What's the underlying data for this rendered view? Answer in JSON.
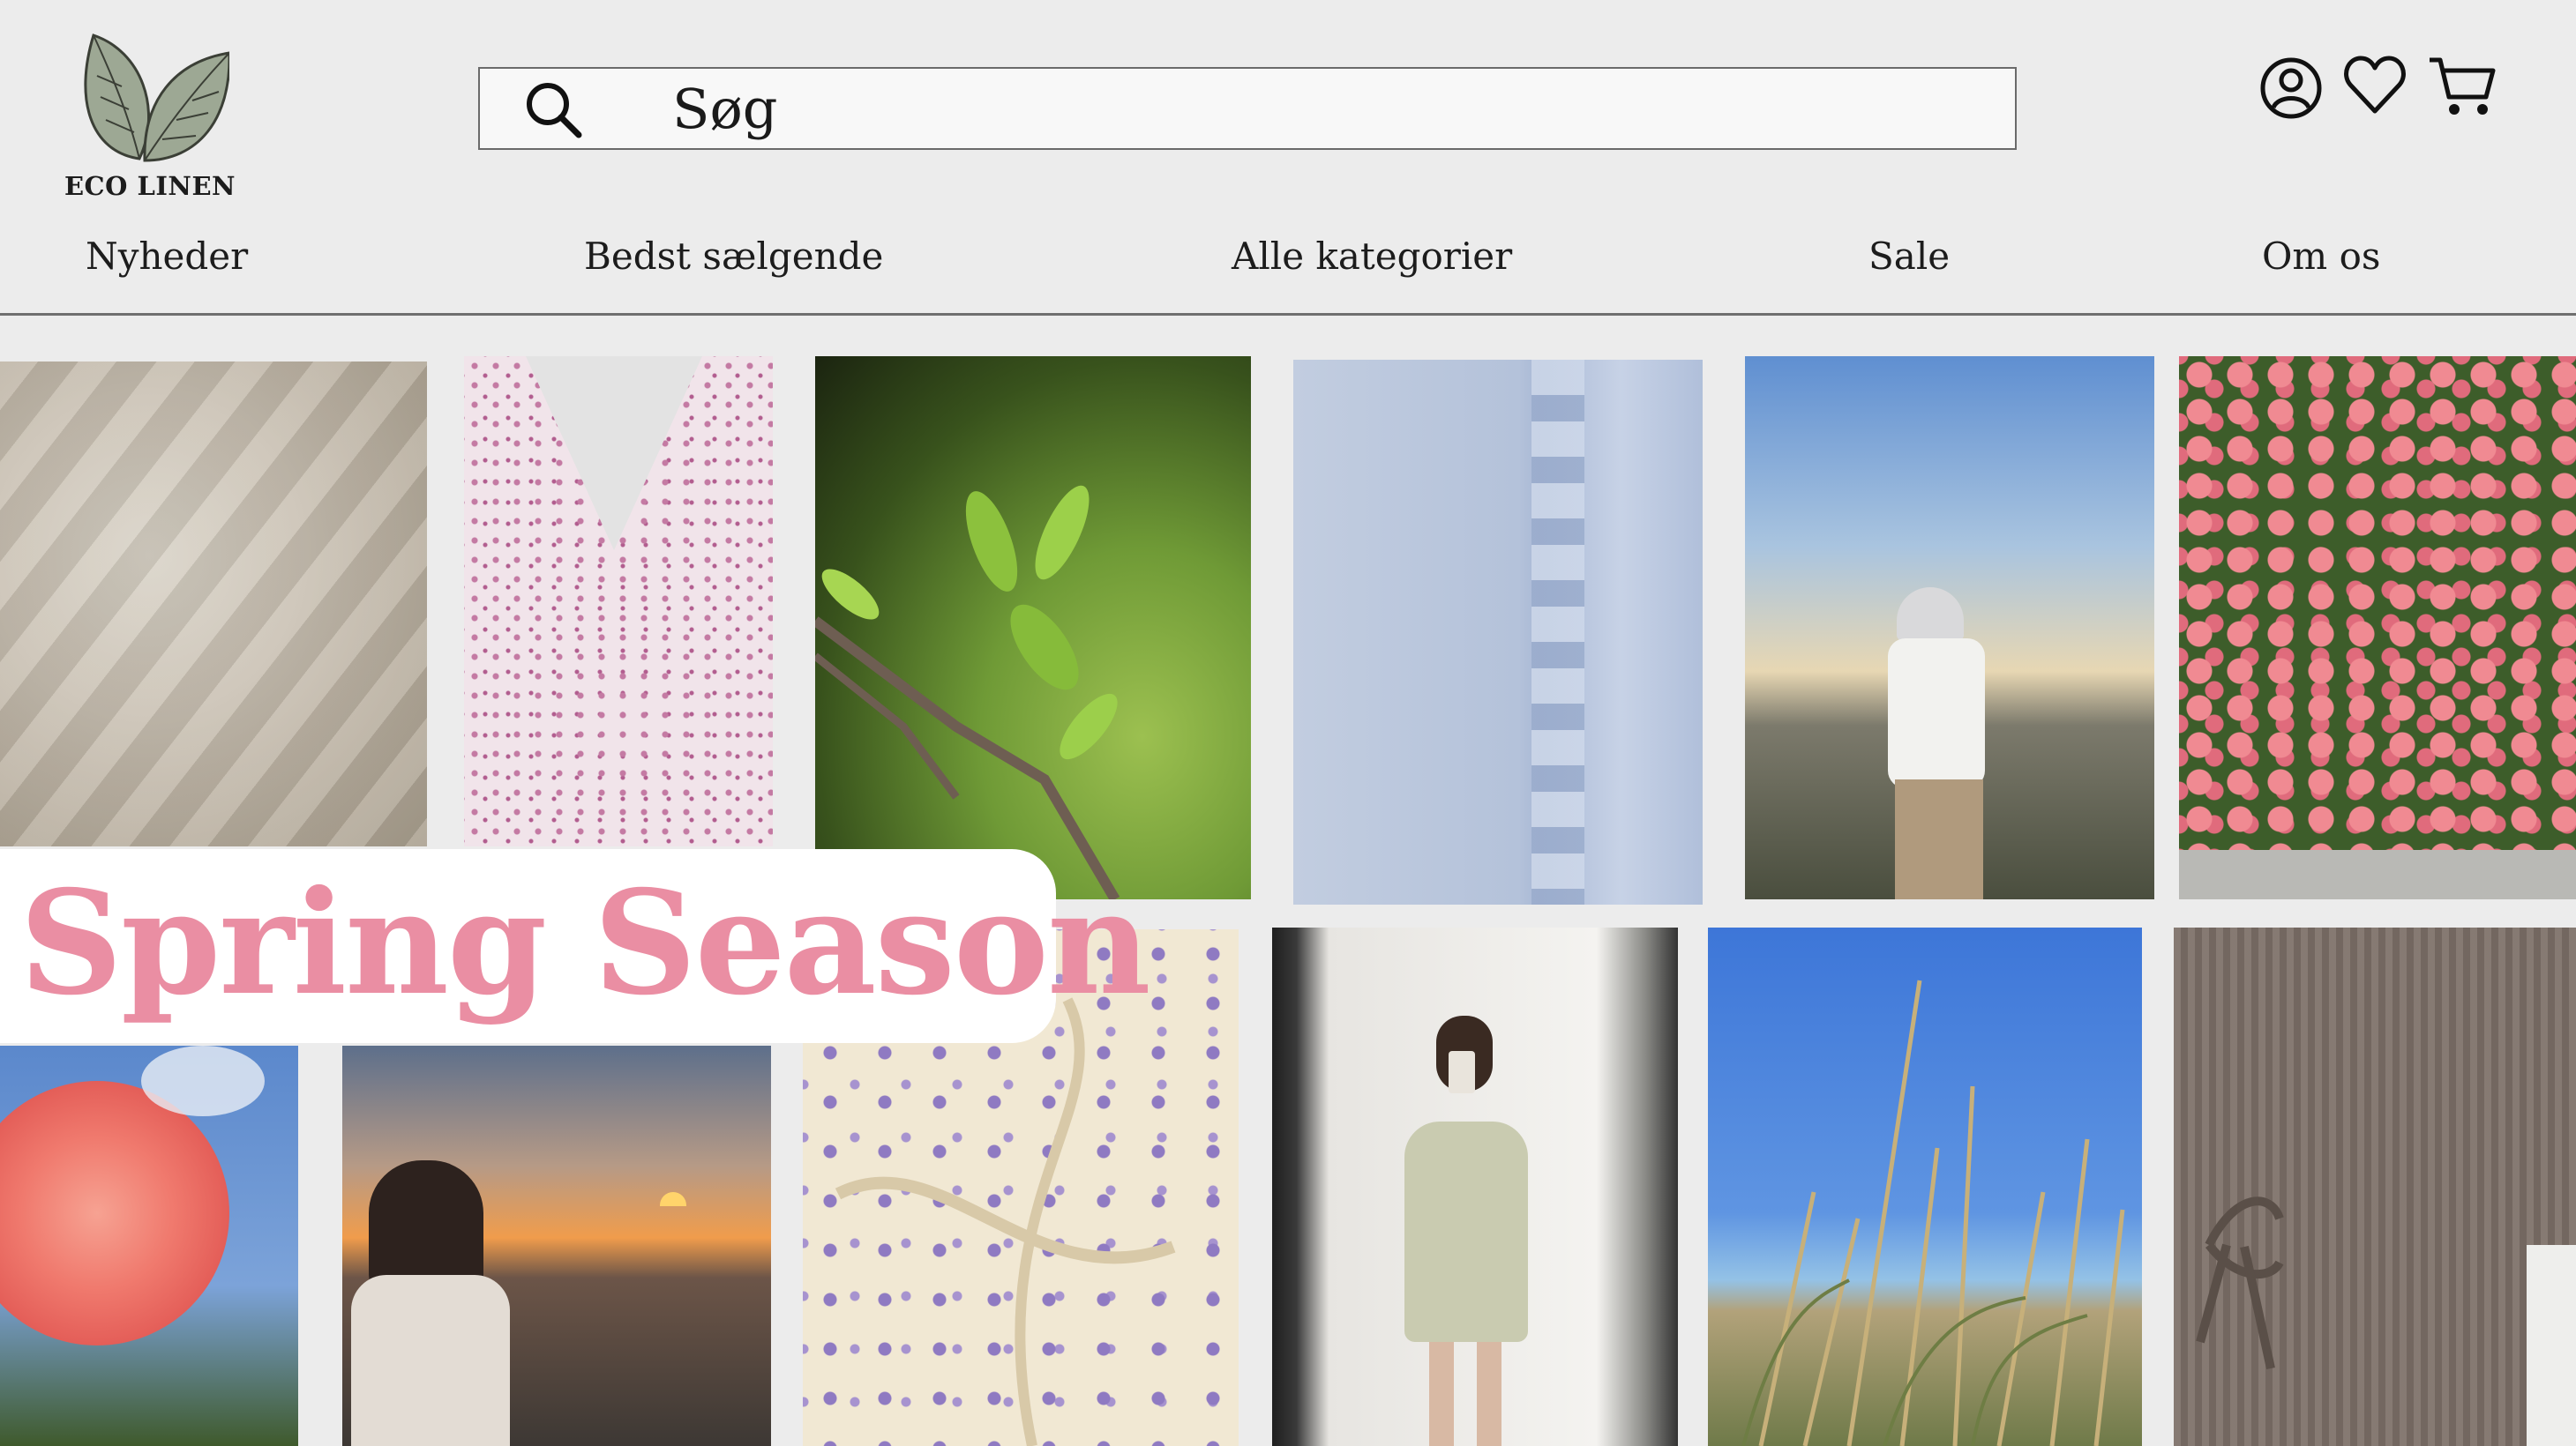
{
  "brand": {
    "name": "ECO LINEN",
    "leaf_color": "#9da894",
    "leaf_stroke": "#3b3f36"
  },
  "search": {
    "value": "",
    "placeholder": "Søg"
  },
  "header_icons": [
    "account-icon",
    "heart-icon",
    "cart-icon"
  ],
  "nav": [
    "Nyheder",
    "Bedst sælgende",
    "Alle kategorier",
    "Sale",
    "Om os"
  ],
  "banner": {
    "text": "Spring Season",
    "color": "#ea8ea3"
  },
  "gallery": [
    "Beige linen fabric",
    "Pink floral dress",
    "Spring branch with leaves",
    "Light blue ruffled fabric",
    "Woman in bucket hat on mountain",
    "Pink oleander tree",
    "Red rose against sky",
    "Woman watching sunset",
    "Cream floral dress fabric",
    "Woman in floral dress mirror selfie",
    "Beach grass and sea",
    "Brown knit cardigan"
  ]
}
